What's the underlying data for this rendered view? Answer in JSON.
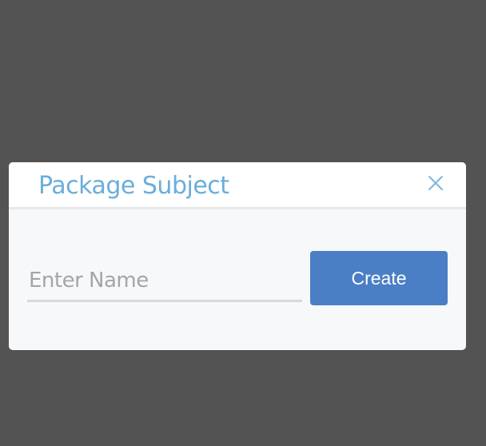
{
  "modal": {
    "title": "Package Subject",
    "close_icon": "close-icon",
    "name_input": {
      "value": "",
      "placeholder": "Enter Name"
    },
    "create_label": "Create"
  },
  "colors": {
    "backdrop": "#535353",
    "title": "#6aaedb",
    "primary_button": "#4a7fc5",
    "modal_body": "#f7f8fa"
  }
}
